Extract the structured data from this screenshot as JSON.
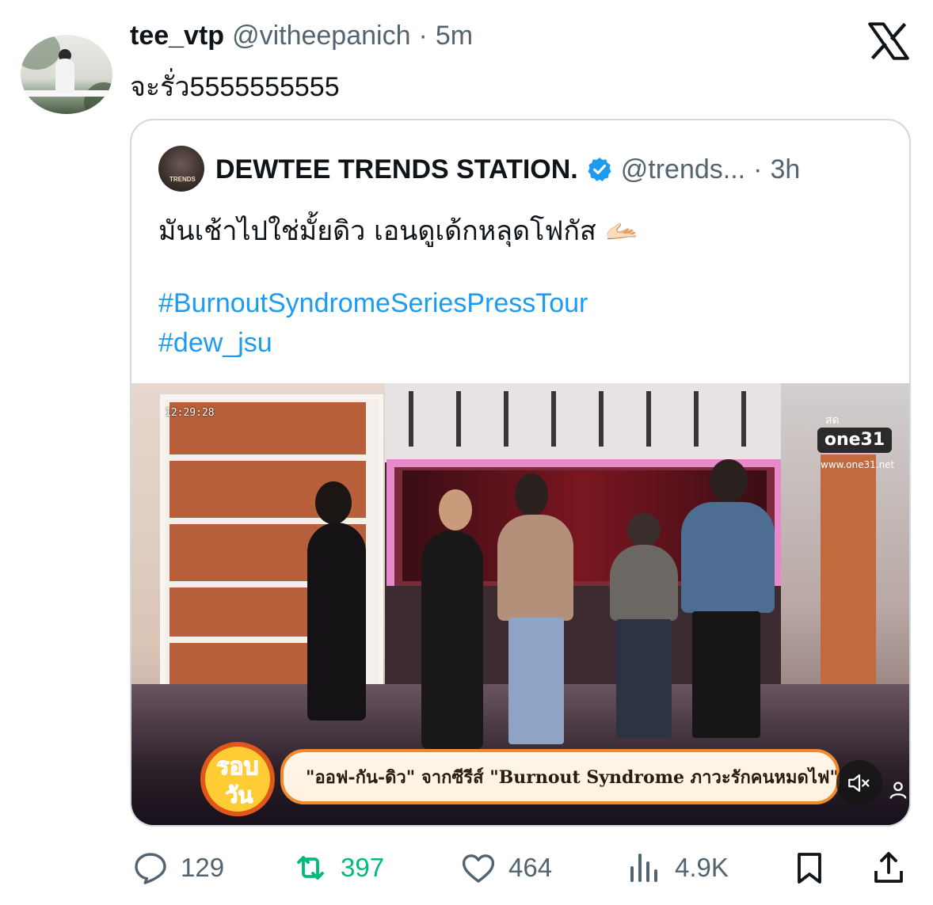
{
  "outer_tweet": {
    "display_name": "tee_vtp",
    "handle": "@vitheepanich",
    "dot": "·",
    "time": "5m",
    "text": "จะรั่ว5555555555"
  },
  "quoted_tweet": {
    "display_name": "DEWTEE TRENDS STATION.",
    "avatar_text": "TRENDS",
    "handle": "@trends...",
    "dot": "·",
    "time": "3h",
    "text": "มันเช้าไปใช่มั้ยดิว เอนดูเด้กหลุดโฟกัส 🫴🏻",
    "hashtags": [
      "#BurnoutSyndromeSeriesPressTour",
      "#dew_jsu"
    ]
  },
  "video": {
    "timecode": "12:29:28",
    "channel_small": "สด",
    "channel_logo": "one31",
    "channel_url": "www.one31.net",
    "show_logo": "รอบวัน",
    "lower_third": "\"ออฟ-กัน-ดิว\" จากซีรีส์ \"Burnout Syndrome ภาวะรักคนหมดไฟ\""
  },
  "actions": {
    "replies": "129",
    "reposts": "397",
    "likes": "464",
    "views": "4.9K"
  },
  "colors": {
    "accent_blue": "#1d9bf0",
    "repost_green": "#00ba7c",
    "muted": "#536471",
    "verified": "#1d9bf0"
  },
  "icons": [
    "x-logo-icon",
    "verified-badge-icon",
    "reply-icon",
    "repost-icon",
    "like-icon",
    "views-icon",
    "bookmark-icon",
    "share-icon",
    "mute-icon",
    "person-icon"
  ]
}
